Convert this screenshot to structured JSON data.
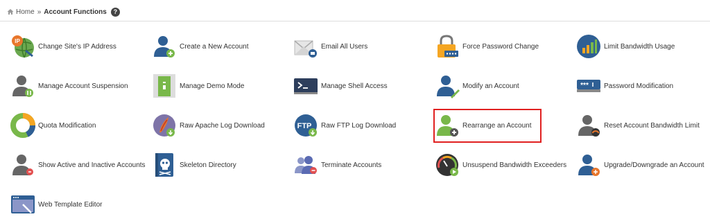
{
  "breadcrumb": {
    "home": "Home",
    "separator": "»",
    "current": "Account Functions",
    "help": "?"
  },
  "items": [
    {
      "label": "Change Site's IP Address",
      "icon": "ip-globe-icon"
    },
    {
      "label": "Create a New Account",
      "icon": "user-add-icon"
    },
    {
      "label": "Email All Users",
      "icon": "email-icon"
    },
    {
      "label": "Force Password Change",
      "icon": "padlock-icon"
    },
    {
      "label": "Limit Bandwidth Usage",
      "icon": "bar-chart-icon"
    },
    {
      "label": "Manage Account Suspension",
      "icon": "user-suspend-icon"
    },
    {
      "label": "Manage Demo Mode",
      "icon": "demo-door-icon"
    },
    {
      "label": "Manage Shell Access",
      "icon": "terminal-icon"
    },
    {
      "label": "Modify an Account",
      "icon": "user-edit-icon"
    },
    {
      "label": "Password Modification",
      "icon": "password-field-icon"
    },
    {
      "label": "Quota Modification",
      "icon": "pie-quota-icon"
    },
    {
      "label": "Raw Apache Log Download",
      "icon": "apache-feather-icon"
    },
    {
      "label": "Raw FTP Log Download",
      "icon": "ftp-download-icon"
    },
    {
      "label": "Rearrange an Account",
      "icon": "user-rearrange-icon"
    },
    {
      "label": "Reset Account Bandwidth Limit",
      "icon": "user-gauge-icon"
    },
    {
      "label": "Show Active and Inactive Accounts",
      "icon": "user-status-icon"
    },
    {
      "label": "Skeleton Directory",
      "icon": "skull-book-icon"
    },
    {
      "label": "Terminate Accounts",
      "icon": "users-remove-icon"
    },
    {
      "label": "Unsuspend Bandwidth Exceeders",
      "icon": "gauge-play-icon"
    },
    {
      "label": "Upgrade/Downgrade an Account",
      "icon": "user-upgrade-icon"
    },
    {
      "label": "Web Template Editor",
      "icon": "web-template-icon"
    }
  ],
  "highlighted": "Rearrange an Account",
  "colors": {
    "user_blue": "#2f5f94",
    "user_gray": "#666666",
    "user_green": "#79b84a",
    "highlight_red": "#e02020",
    "padlock_orange": "#f5a623"
  }
}
